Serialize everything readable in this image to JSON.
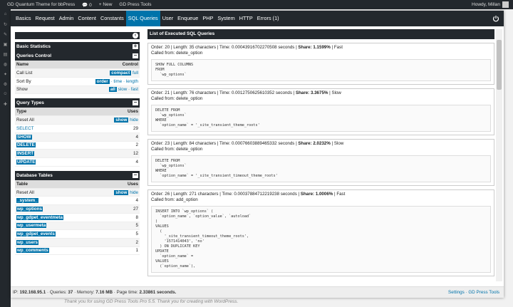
{
  "adminbar": {
    "site": "GD Quantum Theme for bbPress",
    "comments": "0",
    "new": "+ New",
    "plugin": "GD Press Tools",
    "howdy": "Howdy, Millan"
  },
  "footer": "Thank you for using GD Press Tools Pro 5.5. Thank you for creating with WordPress.",
  "tabs": [
    "Basics",
    "Request",
    "Admin",
    "Content",
    "Constants",
    "SQL Queries",
    "User",
    "Enqueue",
    "PHP",
    "System",
    "HTTP",
    "Errors (1)"
  ],
  "active_tab": "SQL Queries",
  "left": {
    "basic_statistics": "Basic Statistics",
    "queries_control": {
      "title": "Queries Control",
      "col_name": "Name",
      "col_control": "Control",
      "rows": [
        {
          "name": "Call List",
          "active": "compact",
          "rest": "full"
        },
        {
          "name": "Sort By",
          "active": "order",
          "rest": "· time · length"
        },
        {
          "name": "Show",
          "active": "all",
          "rest": "slow · fast"
        }
      ]
    },
    "query_types": {
      "title": "Query Types",
      "col_type": "Type",
      "col_uses": "Uses",
      "reset_label": "Reset All",
      "reset_show": "show",
      "reset_hide": "hide",
      "rows": [
        {
          "type": "SELECT",
          "uses": "29"
        },
        {
          "type": "SHOW",
          "uses": "4"
        },
        {
          "type": "DELETE",
          "uses": "2"
        },
        {
          "type": "INSERT",
          "uses": "12"
        },
        {
          "type": "UPDATE",
          "uses": "4"
        }
      ]
    },
    "database_tables": {
      "title": "Database Tables",
      "col_table": "Table",
      "col_uses": "Uses",
      "reset_label": "Reset All",
      "reset_show": "show",
      "reset_hide": "hide",
      "rows": [
        {
          "table": "_system_",
          "uses": "4"
        },
        {
          "table": "wp_options",
          "uses": "27"
        },
        {
          "table": "wp_gdpet_eventmeta",
          "uses": "8"
        },
        {
          "table": "wp_usermeta",
          "uses": "5"
        },
        {
          "table": "wp_gdpet_events",
          "uses": "5"
        },
        {
          "table": "wp_users",
          "uses": "2"
        },
        {
          "table": "wp_comments",
          "uses": "1"
        }
      ]
    }
  },
  "right": {
    "title": "List of Executed SQL Queries",
    "queries": [
      {
        "order": "Order: 20",
        "length": "Length: 35 characters",
        "time": "Time: 0.00043916702270508 seconds",
        "share": "Share: 1.1599%",
        "speed": "Fast",
        "called": "delete_option",
        "sql": "SHOW FULL COLUMNS\nFROM\n  `wp_options`"
      },
      {
        "order": "Order: 21",
        "length": "Length: 76 characters",
        "time": "Time: 0.0012750625610352 seconds",
        "share": "Share: 3.3675%",
        "speed": "Slow",
        "called": "delete_option",
        "sql": "DELETE FROM\n  `wp_options`\nWHERE\n  `option_name` = '_site_transient_theme_roots'"
      },
      {
        "order": "Order: 23",
        "length": "Length: 84 characters",
        "time": "Time: 0.00076603889465332 seconds",
        "share": "Share: 2.0232%",
        "speed": "Slow",
        "called": "delete_option",
        "sql": "DELETE FROM\n  `wp_options`\nWHERE\n  `option_name` = '_site_transient_timeout_theme_roots'"
      },
      {
        "order": "Order: 26",
        "length": "Length: 271 characters",
        "time": "Time: 0.00037884712219238 seconds",
        "share": "Share: 1.0006%",
        "speed": "Fast",
        "called": "add_option",
        "sql": "INSERT INTO `wp_options` (\n  `option_name`, `option_value`, `autoload`\n)\nVALUES\n  (\n    '_site_transient_timeout_theme_roots',\n    '1571414043', 'no'\n  ) ON DUPLICATE KEY\nUPDATE\n  `option_name` =\nVALUES\n  (`option_name`),"
      }
    ],
    "called_label": "Called from: "
  },
  "status": {
    "ip_label": "IP: ",
    "ip": "192.168.95.1",
    "queries_label": " · Queries: ",
    "queries": "37",
    "memory_label": " · Memory: ",
    "memory": "7.16 MB",
    "time_label": " · Page time: ",
    "time": "2.33861 seconds.",
    "right": "Settings · GD Press Tools"
  },
  "colors": {
    "accent": "#0073aa",
    "dark": "#23282d"
  }
}
